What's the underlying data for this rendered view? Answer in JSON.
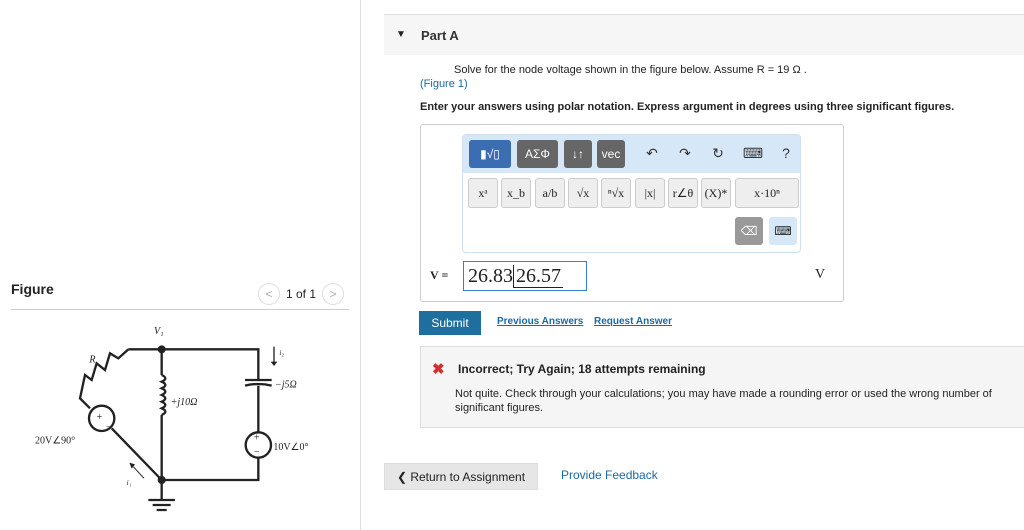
{
  "figure": {
    "title": "Figure",
    "pager": "1 of 1",
    "prev_icon": "chevron-left-icon",
    "next_icon": "chevron-right-icon",
    "labels": {
      "node": "V₁",
      "resistor": "R",
      "source1": "20V∠90°",
      "inductor": "+j10Ω",
      "capacitor": "−j5Ω",
      "source2": "10V∠0°",
      "i1": "i₁",
      "i2": "i₂"
    }
  },
  "part": {
    "title": "Part A",
    "question": "Solve for the node voltage shown in the figure below. Assume R = 19 Ω .",
    "figure_link": "(Figure 1)",
    "instructions": "Enter your answers using polar notation. Express argument in degrees using three significant figures."
  },
  "toolbar": {
    "templates": "▮√▯",
    "greek": "ΑΣΦ",
    "arrows": "↓↑",
    "vec": "vec",
    "undo": "↶",
    "redo": "↷",
    "reset": "↻",
    "keyboard": "⌨",
    "help": "?",
    "buttons": [
      "xᵃ",
      "x_b",
      "a/b",
      "√x",
      "ⁿ√x",
      "|x|",
      "r∠θ",
      "(X)*",
      "x·10ⁿ"
    ],
    "backspace": "⌫",
    "kbd2": "⌨"
  },
  "answer": {
    "label": "V =",
    "magnitude": "26.83",
    "angle": "26.57",
    "unit": "V"
  },
  "actions": {
    "submit": "Submit",
    "previous": "Previous Answers",
    "request": "Request Answer"
  },
  "feedback": {
    "title": "Incorrect; Try Again; 18 attempts remaining",
    "message": "Not quite. Check through your calculations; you may have made a rounding error or used the wrong number of significant figures.",
    "color": "#d0312d"
  },
  "footer": {
    "return": "Return to Assignment",
    "feedback": "Provide Feedback"
  }
}
